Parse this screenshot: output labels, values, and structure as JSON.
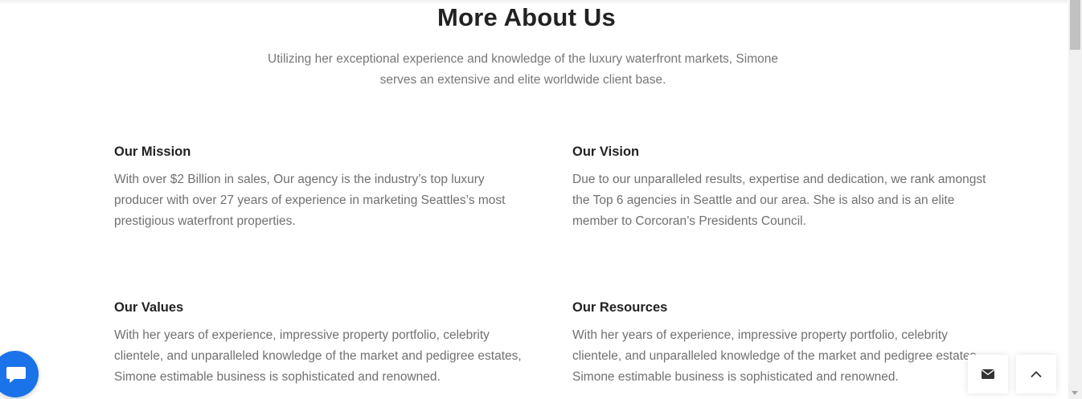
{
  "section": {
    "title": "More About Us",
    "subtitle": "Utilizing her exceptional experience and knowledge of the luxury waterfront markets, Simone serves an extensive and elite worldwide client base."
  },
  "cards": [
    {
      "title": "Our Mission",
      "text": "With over $2 Billion in sales, Our agency is the industry’s top luxury producer with over 27 years of experience in marketing Seattles’s most prestigious waterfront properties."
    },
    {
      "title": "Our Vision",
      "text": "Due to our unparalleled results, expertise and dedication, we rank amongst the Top 6 agencies in Seattle and our area. She is also and is an elite member to Corcoran’s Presidents Council."
    },
    {
      "title": "Our Values",
      "text": "With her years of experience, impressive property portfolio, celebrity clientele, and unparalleled knowledge of the market and pedigree estates, Simone estimable business is sophisticated and renowned."
    },
    {
      "title": "Our Resources",
      "text": "With her years of experience, impressive property portfolio, celebrity clientele, and unparalleled knowledge of the market and pedigree estates, Simone estimable business is sophisticated and renowned."
    }
  ],
  "icons": {
    "chat": "chat-icon",
    "email": "envelope-icon",
    "back_to_top": "chevron-up-icon"
  },
  "colors": {
    "chat_button": "#1a73e8",
    "heading": "#222222",
    "body_text": "#707070"
  }
}
